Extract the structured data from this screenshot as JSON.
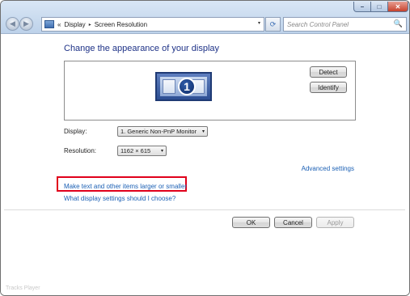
{
  "window": {
    "controls": {
      "minimize": "–",
      "maximize": "□",
      "close": "✕"
    }
  },
  "nav": {
    "back_glyph": "◀",
    "forward_glyph": "▶",
    "address": {
      "crumb_prefix": "«",
      "crumbs": [
        "Display",
        "Screen Resolution"
      ],
      "separator": "▸",
      "dropdown_glyph": "▾"
    },
    "refresh_glyph": "⟳",
    "search_placeholder": "Search Control Panel",
    "search_glyph": "🔍"
  },
  "main": {
    "title": "Change the appearance of your display",
    "monitor": {
      "number": "1"
    },
    "detect_label": "Detect",
    "identify_label": "Identify",
    "display": {
      "label": "Display:",
      "value": "1. Generic Non-PnP Monitor"
    },
    "resolution": {
      "label": "Resolution:",
      "value": "1162 × 615"
    },
    "select_arrow": "▾",
    "advanced_settings": "Advanced settings",
    "make_text_link": "Make text and other items larger or smaller",
    "help_link": "What display settings should I choose?"
  },
  "footer": {
    "ok_label": "OK",
    "cancel_label": "Cancel",
    "apply_label": "Apply"
  },
  "watermark": "Tracks Player",
  "colors": {
    "title": "#1e3287",
    "link": "#1a5fb4",
    "highlight": "#e0001b"
  }
}
